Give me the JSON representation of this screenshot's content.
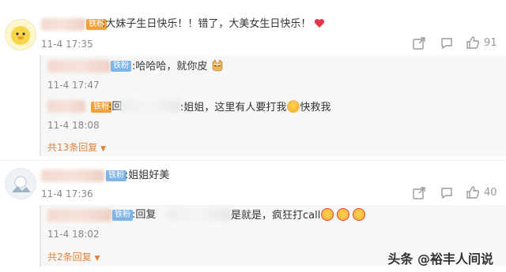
{
  "comment1": {
    "badge": "铁粉",
    "text": ":大妹子生日快乐！！错了，大美女生日快乐！",
    "time": "11-4 17:35",
    "likes": "91",
    "replies": [
      {
        "badge": "铁粉",
        "text": ":哈哈哈，就你皮",
        "time": "11-4 17:47"
      },
      {
        "badge": "铁粉",
        "prefix": ":回",
        "text": ":姐姐，这里有人要打我",
        "suffix": "快救我",
        "time": "11-4 18:08"
      }
    ],
    "more_label": "共13条回复"
  },
  "comment2": {
    "badge": "铁粉",
    "text": ":姐姐好美",
    "time": "11-4 17:36",
    "likes": "40",
    "replies": [
      {
        "badge": "铁粉",
        "prefix": ":回复",
        "text": "是就是，疯狂打call",
        "time": "11-4 18:02"
      }
    ],
    "more_label": "共2条回复"
  },
  "watermark": "头条 @裕丰人间说",
  "colors": {
    "heart": "#e8344e",
    "more": "#e0823c",
    "badge": "#7fb5e6"
  }
}
